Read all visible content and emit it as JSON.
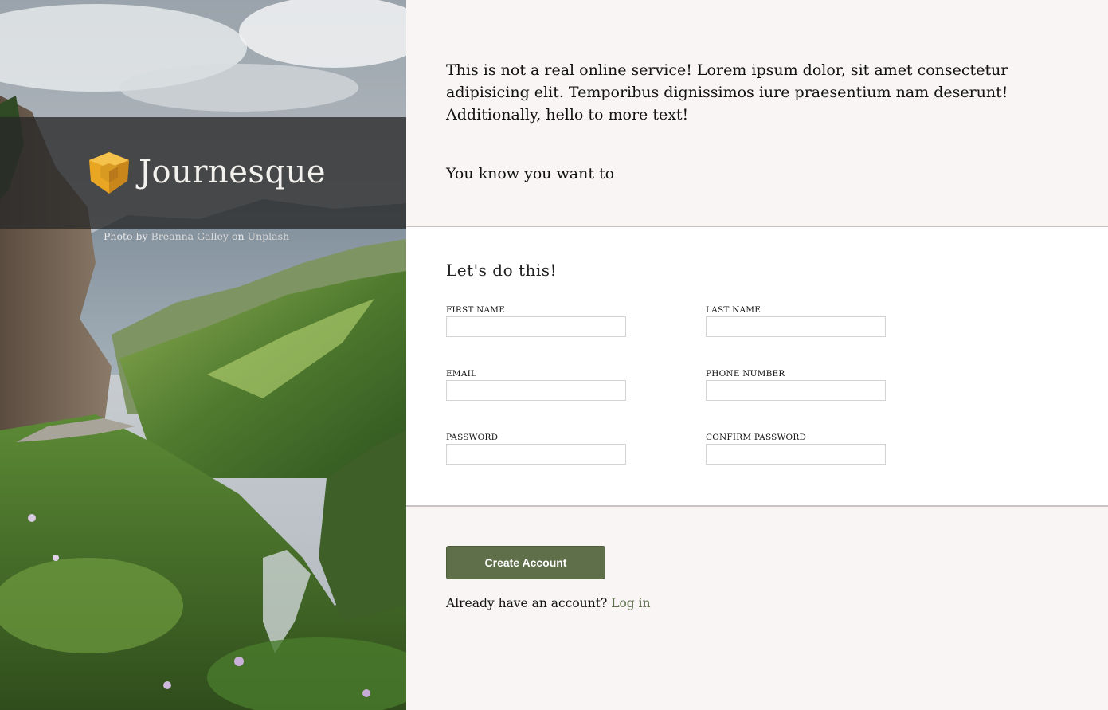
{
  "brand": {
    "name": "Journesque",
    "logo_icon": "shield-cube-icon",
    "logo_color": "#e8a623"
  },
  "photo_credit": {
    "prefix": "Photo by",
    "author": "Breanna Galley",
    "middle": "on",
    "source": "Unplash"
  },
  "intro": {
    "text": "This is not a real online service! Lorem ipsum dolor, sit amet consectetur adipisicing elit. Temporibus dignissimos iure praesentium nam deserunt! Additionally, hello to more text!",
    "tagline": "You know you want to"
  },
  "form": {
    "heading": "Let's do this!",
    "fields": {
      "first_name": {
        "label": "FIRST NAME",
        "value": ""
      },
      "last_name": {
        "label": "LAST NAME",
        "value": ""
      },
      "email": {
        "label": "EMAIL",
        "value": ""
      },
      "phone": {
        "label": "PHONE NUMBER",
        "value": ""
      },
      "password": {
        "label": "PASSWORD",
        "value": ""
      },
      "confirm_password": {
        "label": "CONFIRM PASSWORD",
        "value": ""
      }
    }
  },
  "actions": {
    "create_label": "Create Account",
    "login_prompt": "Already have an account?",
    "login_link": "Log in"
  },
  "colors": {
    "accent": "#5e6f4a",
    "background": "#f8f5f4",
    "form_bg": "#ffffff"
  }
}
